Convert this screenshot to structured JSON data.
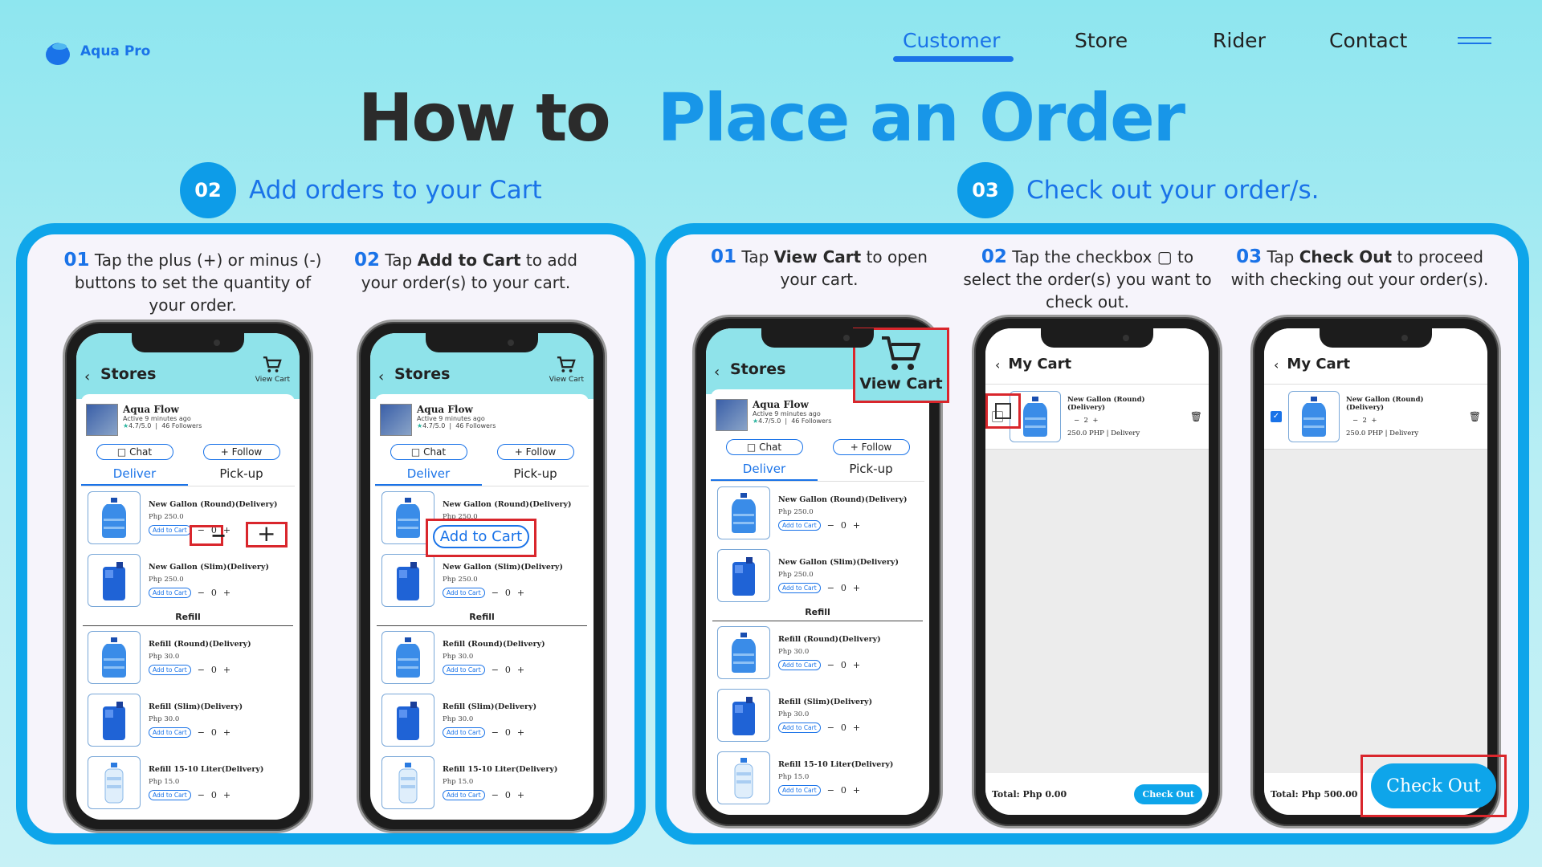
{
  "brand": {
    "name": "Aqua Pro"
  },
  "nav": {
    "items": [
      "Customer",
      "Store",
      "Rider",
      "Contact"
    ],
    "active": "Customer"
  },
  "title": {
    "part1": "How to",
    "part2": "Place an Order"
  },
  "steps": [
    {
      "num": "02",
      "title": "Add orders to your Cart"
    },
    {
      "num": "03",
      "title": "Check out your order/s."
    }
  ],
  "instructions": {
    "a1": {
      "num": "01",
      "pre": "Tap the plus (+) or minus (-) buttons to set the quantity of your order.",
      "bold": "",
      "post": ""
    },
    "a2": {
      "num": "02",
      "pre": "Tap ",
      "bold": "Add to Cart",
      "post": " to add your order(s) to your cart."
    },
    "b1": {
      "num": "01",
      "pre": "Tap ",
      "bold": "View Cart",
      "post": " to open your cart."
    },
    "b2": {
      "num": "02",
      "pre": "Tap the checkbox ▢ to select the order(s) you want to check out.",
      "bold": "",
      "post": ""
    },
    "b3": {
      "num": "03",
      "pre": "Tap ",
      "bold": "Check Out",
      "post": " to proceed with checking out your order(s)."
    }
  },
  "app": {
    "stores_title": "Stores",
    "view_cart": "View Cart",
    "store_name": "Aqua Flow",
    "store_active": "Active 9 minutes ago",
    "store_rating": "4.7/5.0",
    "store_followers": "46 Followers",
    "chat": "Chat",
    "follow": "+ Follow",
    "tab_deliver": "Deliver",
    "tab_pickup": "Pick-up",
    "add_to_cart": "Add to Cart",
    "qty": "0",
    "refill_section": "Refill",
    "products": [
      {
        "name": "New Gallon (Round)(Delivery)",
        "price": "Php 250.0",
        "kind": "round"
      },
      {
        "name": "New Gallon (Slim)(Delivery)",
        "price": "Php 250.0",
        "kind": "slim"
      },
      {
        "name": "Refill (Round)(Delivery)",
        "price": "Php 30.0",
        "kind": "round"
      },
      {
        "name": "Refill (Slim)(Delivery)",
        "price": "Php 30.0",
        "kind": "slim"
      },
      {
        "name": "Refill 15-10 Liter(Delivery)",
        "price": "Php 15.0",
        "kind": "bottle"
      }
    ],
    "callout_add_to_cart": "Add to Cart",
    "callout_view_cart": "View Cart",
    "my_cart": "My Cart",
    "cart_item": {
      "name": "New Gallon (Round) (Delivery)",
      "qty": "2",
      "price": "250.0 PHP | Delivery"
    },
    "total_empty": "Total: Php 0.00",
    "total_full": "Total: Php 500.00",
    "check_out": "Check Out",
    "callout_check_out": "Check Out"
  },
  "colors": {
    "accent": "#1a73e8",
    "panel_border": "#0ea5ea",
    "highlight": "#d9262c",
    "appbar": "#8fe3ea"
  }
}
